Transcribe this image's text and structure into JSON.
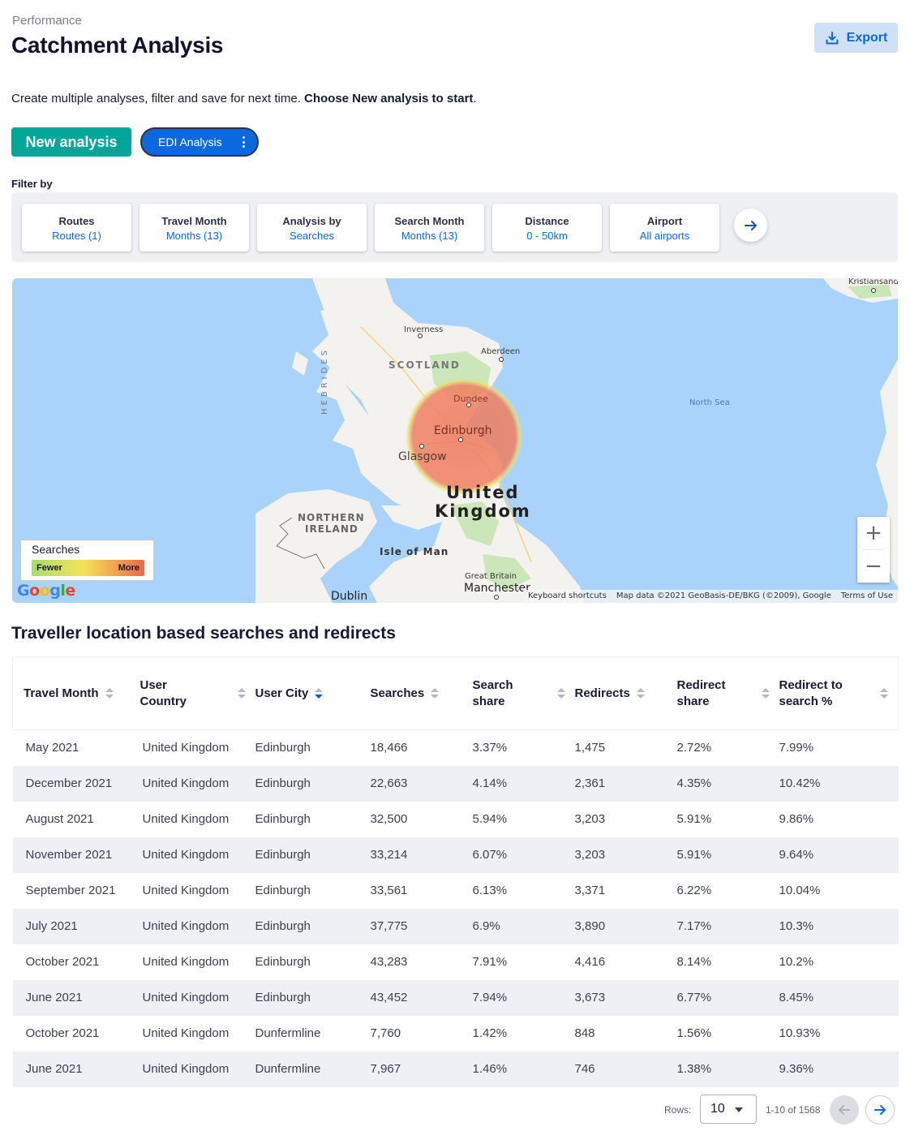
{
  "header": {
    "breadcrumb": "Performance",
    "title": "Catchment Analysis",
    "export_label": "Export"
  },
  "intro": {
    "text": "Create multiple analyses, filter and save for next time. ",
    "bold": "Choose New analysis to start",
    "end": "."
  },
  "actions": {
    "new_analysis_label": "New analysis",
    "saved_analysis_label": "EDI Analysis"
  },
  "filters": {
    "label": "Filter by",
    "items": [
      {
        "title": "Routes",
        "value": "Routes (1)"
      },
      {
        "title": "Travel Month",
        "value": "Months (13)"
      },
      {
        "title": "Analysis by",
        "value": "Searches"
      },
      {
        "title": "Search Month",
        "value": "Months (13)"
      },
      {
        "title": "Distance",
        "value": "0 - 50km"
      },
      {
        "title": "Airport",
        "value": "All airports"
      }
    ]
  },
  "map": {
    "labels": {
      "kristiansand": "Kristiansand",
      "inverness": "Inverness",
      "aberdeen": "Aberdeen",
      "hebrides": "HEBRIDES",
      "scotland": "SCOTLAND",
      "north_sea": "North Sea",
      "dundee": "Dundee",
      "edinburgh": "Edinburgh",
      "glasgow": "Glasgow",
      "united": "United",
      "kingdom": "Kingdom",
      "northern": "NORTHERN",
      "ireland": "IRELAND",
      "isle_of_man": "Isle of Man",
      "great_britain": "Great Britain",
      "manchester": "Manchester",
      "dublin": "Dublin"
    },
    "legend": {
      "title": "Searches",
      "low": "Fewer",
      "high": "More"
    },
    "google": "Google",
    "zoom_in": "+",
    "zoom_out": "−",
    "attribution": {
      "shortcuts": "Keyboard shortcuts",
      "data": "Map data ©2021 GeoBasis-DE/BKG (©2009), Google",
      "terms": "Terms of Use"
    },
    "heat_color": "#ee7a5e"
  },
  "table": {
    "title": "Traveller location based searches and redirects",
    "columns": [
      "Travel Month",
      "User Country",
      "User City",
      "Searches",
      "Search share",
      "Redirects",
      "Redirect share",
      "Redirect to search %"
    ],
    "sorted_column": "User City",
    "rows": [
      [
        "May 2021",
        "United Kingdom",
        "Edinburgh",
        "18,466",
        "3.37%",
        "1,475",
        "2.72%",
        "7.99%"
      ],
      [
        "December 2021",
        "United Kingdom",
        "Edinburgh",
        "22,663",
        "4.14%",
        "2,361",
        "4.35%",
        "10.42%"
      ],
      [
        "August 2021",
        "United Kingdom",
        "Edinburgh",
        "32,500",
        "5.94%",
        "3,203",
        "5.91%",
        "9.86%"
      ],
      [
        "November 2021",
        "United Kingdom",
        "Edinburgh",
        "33,214",
        "6.07%",
        "3,203",
        "5.91%",
        "9.64%"
      ],
      [
        "September 2021",
        "United Kingdom",
        "Edinburgh",
        "33,561",
        "6.13%",
        "3,371",
        "6.22%",
        "10.04%"
      ],
      [
        "July 2021",
        "United Kingdom",
        "Edinburgh",
        "37,775",
        "6.9%",
        "3,890",
        "7.17%",
        "10.3%"
      ],
      [
        "October 2021",
        "United Kingdom",
        "Edinburgh",
        "43,283",
        "7.91%",
        "4,416",
        "8.14%",
        "10.2%"
      ],
      [
        "June 2021",
        "United Kingdom",
        "Edinburgh",
        "43,452",
        "7.94%",
        "3,673",
        "6.77%",
        "8.45%"
      ],
      [
        "October 2021",
        "United Kingdom",
        "Dunfermline",
        "7,760",
        "1.42%",
        "848",
        "1.56%",
        "10.93%"
      ],
      [
        "June 2021",
        "United Kingdom",
        "Dunfermline",
        "7,967",
        "1.46%",
        "746",
        "1.38%",
        "9.36%"
      ]
    ]
  },
  "pagination": {
    "rows_label": "Rows:",
    "rows_value": "10",
    "range": "1-10 of 1568"
  }
}
